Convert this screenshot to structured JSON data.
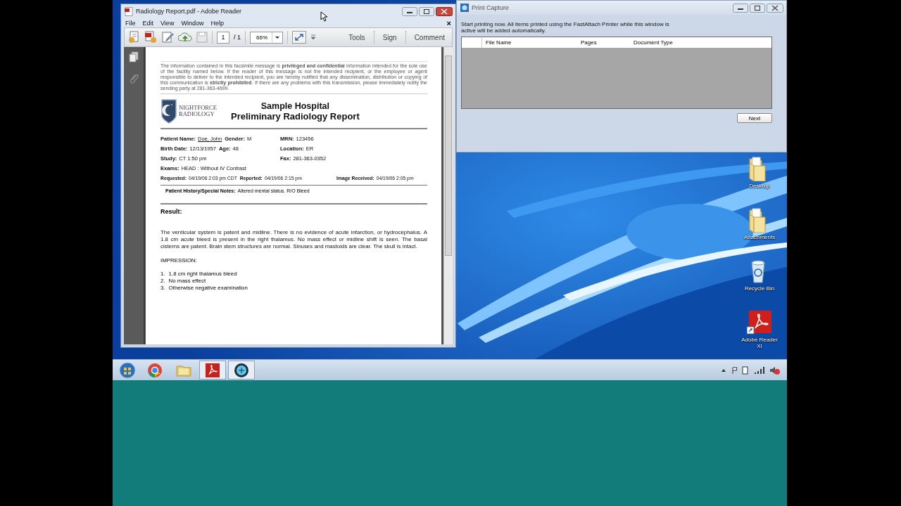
{
  "reader": {
    "title": "Radiology Report.pdf - Adobe Reader",
    "menu": [
      "File",
      "Edit",
      "View",
      "Window",
      "Help"
    ],
    "menu_close": "×",
    "page_number": "1",
    "page_total": "/ 1",
    "zoom": "66%",
    "panel_buttons": [
      "Tools",
      "Sign",
      "Comment"
    ],
    "document": {
      "notice": "The information contained in this facsimile message is **privileged and confidential** information intended for the sole use of the facility named below. If the reader of this message is not the intended recipient, or the employee or agent responsible to deliver to the intended recipient, you are hereby notified that any dissemination, distribution or copying of this communication is **strictly prohibited**. If there are any problems with this transmission, please immediately notify the sending party at 281-363-4699.",
      "logo_lines": [
        "NIGHTFORCE",
        "RADIOLOGY"
      ],
      "hospital": "Sample Hospital",
      "report_title": "Preliminary Radiology Report",
      "rows": [
        {
          "kind": "two_col",
          "groups": [
            [
              {
                "label": "Patient Name:",
                "value": "Doe, John",
                "underlined": true
              },
              {
                "label": "Gender:",
                "value": "M",
                "underlined": false
              }
            ],
            [
              {
                "label": "MRN:",
                "value": "123456",
                "underlined": false
              }
            ]
          ]
        },
        {
          "kind": "two_col",
          "groups": [
            [
              {
                "label": "Birth Date:",
                "value": "12/13/1957",
                "underlined": false
              },
              {
                "label": "Age:",
                "value": "48",
                "underlined": false
              }
            ],
            [
              {
                "label": "Location:",
                "value": "ER",
                "underlined": false
              }
            ]
          ]
        },
        {
          "kind": "two_col",
          "groups": [
            [
              {
                "label": "Study:",
                "value": "CT   1:50 pm",
                "underlined": false
              }
            ],
            [
              {
                "label": "Fax:",
                "value": "281-363-0352",
                "underlined": false
              }
            ]
          ]
        },
        {
          "kind": "two_col",
          "groups": [
            [
              {
                "label": "Exams:",
                "value": "HEAD  : Without IV Contrast",
                "underlined": false
              }
            ]
          ]
        },
        {
          "kind": "spread",
          "groups": [
            [
              {
                "label": "Requested:",
                "value": "04/19/06 2:03 pm CDT",
                "underlined": false
              },
              {
                "label": "Reported:",
                "value": "04/19/06 2:15 pm",
                "underlined": false
              }
            ],
            [
              {
                "label": "Image Received:",
                "value": "04/19/06 2:05 pm",
                "underlined": false
              }
            ]
          ]
        }
      ],
      "notes": {
        "label": "Patient History/Special Notes:",
        "value": "Altered mental status.  R/O Bleed"
      },
      "result_heading": "Result:",
      "findings": "The venticular system is patent and midline.  There is no evidence of acute infarction, or hydrocephalus.  A 1.8 cm acute bleed is present in the right thalamus.  No mass effect or midline shift is seen.  The basal cisterns are patent.   Brain stem structures are normal.  Sinuses and mastoids are clear.  The skull is intact.",
      "impression_heading": "IMPRESSION:",
      "impressions": [
        {
          "number": "1.",
          "text": "1.8 cm right thalamus bleed"
        },
        {
          "number": "2.",
          "text": "No mass effect"
        },
        {
          "number": "3.",
          "text": "Otherwise negative examination"
        }
      ]
    }
  },
  "print_capture": {
    "title": "Print Capture",
    "message": "Start printing now.  All items printed using the FastAttach Printer while this window is active will be added automatically.",
    "columns": [
      "File Name",
      "Pages",
      "Document Type"
    ],
    "button": "Next"
  },
  "desktop_icons": [
    {
      "label": "Desktop",
      "kind": "folder"
    },
    {
      "label": "Attachments",
      "kind": "folder"
    },
    {
      "label": "Recycle Bin",
      "kind": "recycle_bin"
    },
    {
      "label": "Adobe Reader XI",
      "kind": "pdf_shortcut"
    }
  ],
  "taskbar": {
    "items": [
      {
        "kind": "start"
      },
      {
        "kind": "chrome"
      },
      {
        "kind": "explorer"
      },
      {
        "kind": "reader"
      },
      {
        "kind": "capture"
      }
    ]
  }
}
